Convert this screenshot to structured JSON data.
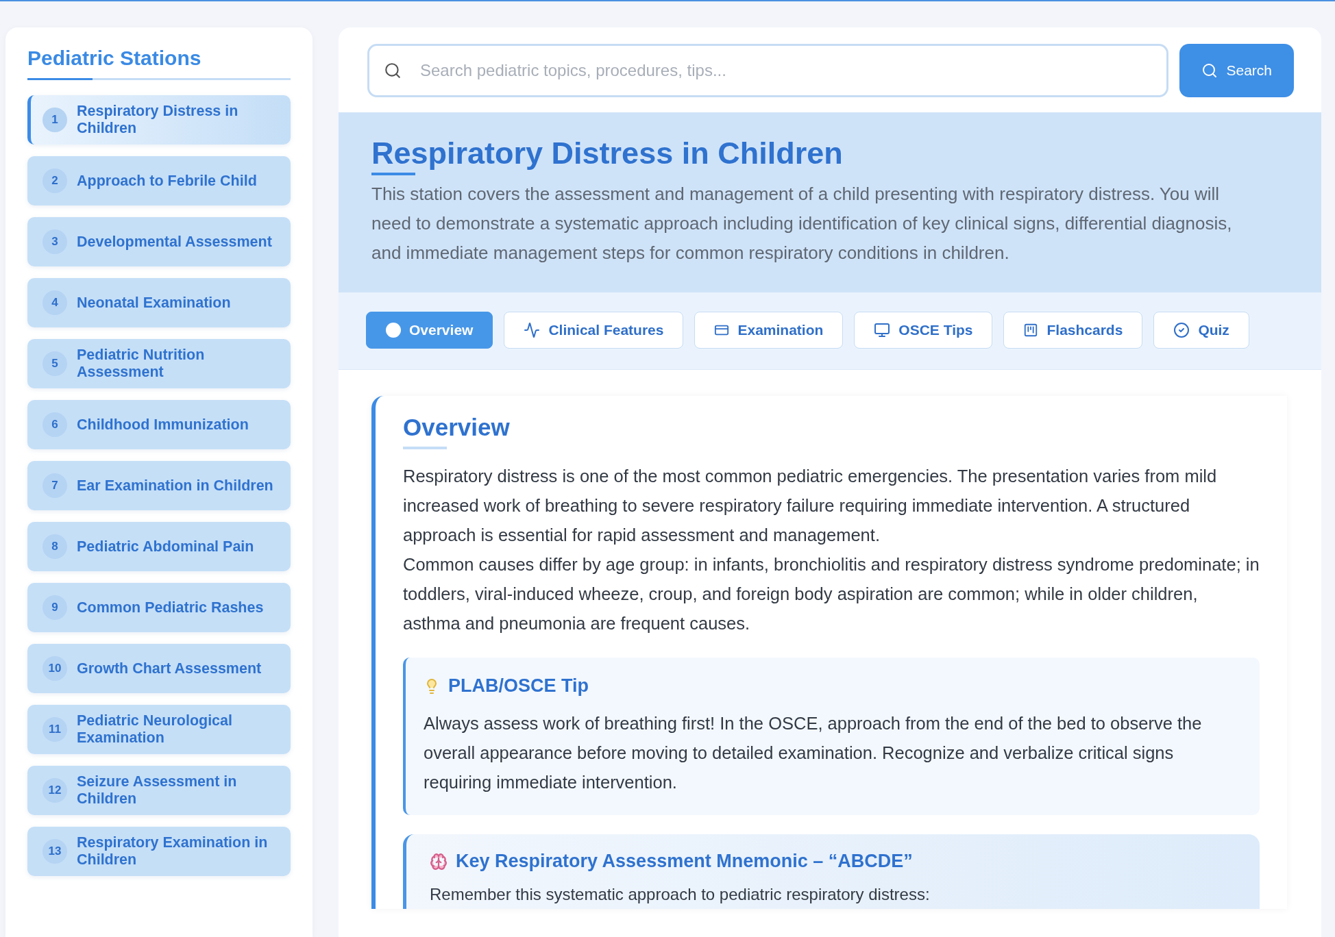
{
  "sidebar": {
    "title": "Pediatric Stations",
    "stations": [
      {
        "number": "1",
        "title": "Respiratory Distress in Children",
        "selected": true
      },
      {
        "number": "2",
        "title": "Approach to Febrile Child",
        "selected": false
      },
      {
        "number": "3",
        "title": "Developmental Assessment",
        "selected": false
      },
      {
        "number": "4",
        "title": "Neonatal Examination",
        "selected": false
      },
      {
        "number": "5",
        "title": "Pediatric Nutrition Assessment",
        "selected": false
      },
      {
        "number": "6",
        "title": "Childhood Immunization",
        "selected": false
      },
      {
        "number": "7",
        "title": "Ear Examination in Children",
        "selected": false
      },
      {
        "number": "8",
        "title": "Pediatric Abdominal Pain",
        "selected": false
      },
      {
        "number": "9",
        "title": "Common Pediatric Rashes",
        "selected": false
      },
      {
        "number": "10",
        "title": "Growth Chart Assessment",
        "selected": false
      },
      {
        "number": "11",
        "title": "Pediatric Neurological Examination",
        "selected": false
      },
      {
        "number": "12",
        "title": "Seizure Assessment in Children",
        "selected": false
      },
      {
        "number": "13",
        "title": "Respiratory Examination in Children",
        "selected": false
      }
    ]
  },
  "search": {
    "placeholder": "Search pediatric topics, procedures, tips...",
    "button": "Search"
  },
  "header": {
    "title": "Respiratory Distress in Children",
    "description": "This station covers the assessment and management of a child presenting with respiratory distress. You will need to demonstrate a systematic approach including identification of key clinical signs, differential diagnosis, and immediate management steps for common respiratory conditions in children."
  },
  "tabs": [
    {
      "label": "Overview",
      "kind": "dot",
      "selected": true
    },
    {
      "label": "Clinical Features",
      "kind": "pulse",
      "selected": false
    },
    {
      "label": "Examination",
      "kind": "card",
      "selected": false
    },
    {
      "label": "OSCE Tips",
      "kind": "monitor",
      "selected": false
    },
    {
      "label": "Flashcards",
      "kind": "board",
      "selected": false
    },
    {
      "label": "Quiz",
      "kind": "check",
      "selected": false
    }
  ],
  "section": {
    "heading": "Overview",
    "paragraphs": [
      "Respiratory distress is one of the most common pediatric emergencies. The presentation varies from mild increased work of breathing to severe respiratory failure requiring immediate intervention. A structured approach is essential for rapid assessment and management.",
      "Common causes differ by age group: in infants, bronchiolitis and respiratory distress syndrome predominate; in toddlers, viral-induced wheeze, croup, and foreign body aspiration are common; while in older children, asthma and pneumonia are frequent causes."
    ],
    "tip": {
      "title": "PLAB/OSCE Tip",
      "text": "Always assess work of breathing first! In the OSCE, approach from the end of the bed to observe the overall appearance before moving to detailed examination. Recognize and verbalize critical signs requiring immediate intervention."
    },
    "mnemonic": {
      "title": "Key Respiratory Assessment Mnemonic – “ABCDE”",
      "text": "Remember this systematic approach to pediatric respiratory distress:"
    }
  }
}
